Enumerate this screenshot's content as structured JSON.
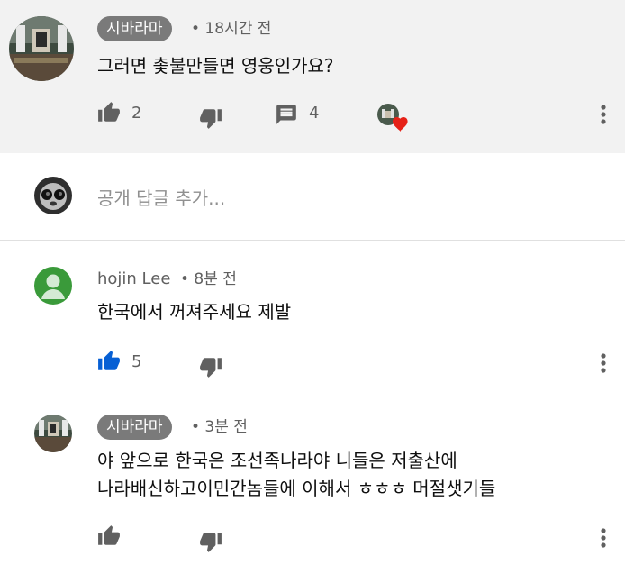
{
  "comments": [
    {
      "author": "시바라마",
      "time": "• 18시간 전",
      "text": "그러면 촟불만들면 영웅인가요?",
      "likes": "2",
      "replies": "4"
    },
    {
      "author": "hojin Lee",
      "time": "• 8분 전",
      "text": "한국에서 꺼져주세요 제발",
      "likes": "5"
    },
    {
      "author": "시바라마",
      "time": "• 3분 전",
      "text_line1": "야 앞으로 한국은 조선족나라야 니들은 저출산에",
      "text_line2": "나라배신하고이민간놈들에 이해서 ㅎㅎㅎ 머절샛기들"
    }
  ],
  "reply_box": {
    "placeholder": "공개 답글 추가..."
  },
  "colors": {
    "top_background": "#f2f2f2",
    "liked_blue": "#065fd4",
    "heart_red": "#e62117",
    "chip_gray": "#7a7a7a"
  },
  "icons": [
    "thumbs-up-icon",
    "thumbs-down-icon",
    "reply-icon",
    "creator-heart-icon",
    "more-vert-icon"
  ]
}
